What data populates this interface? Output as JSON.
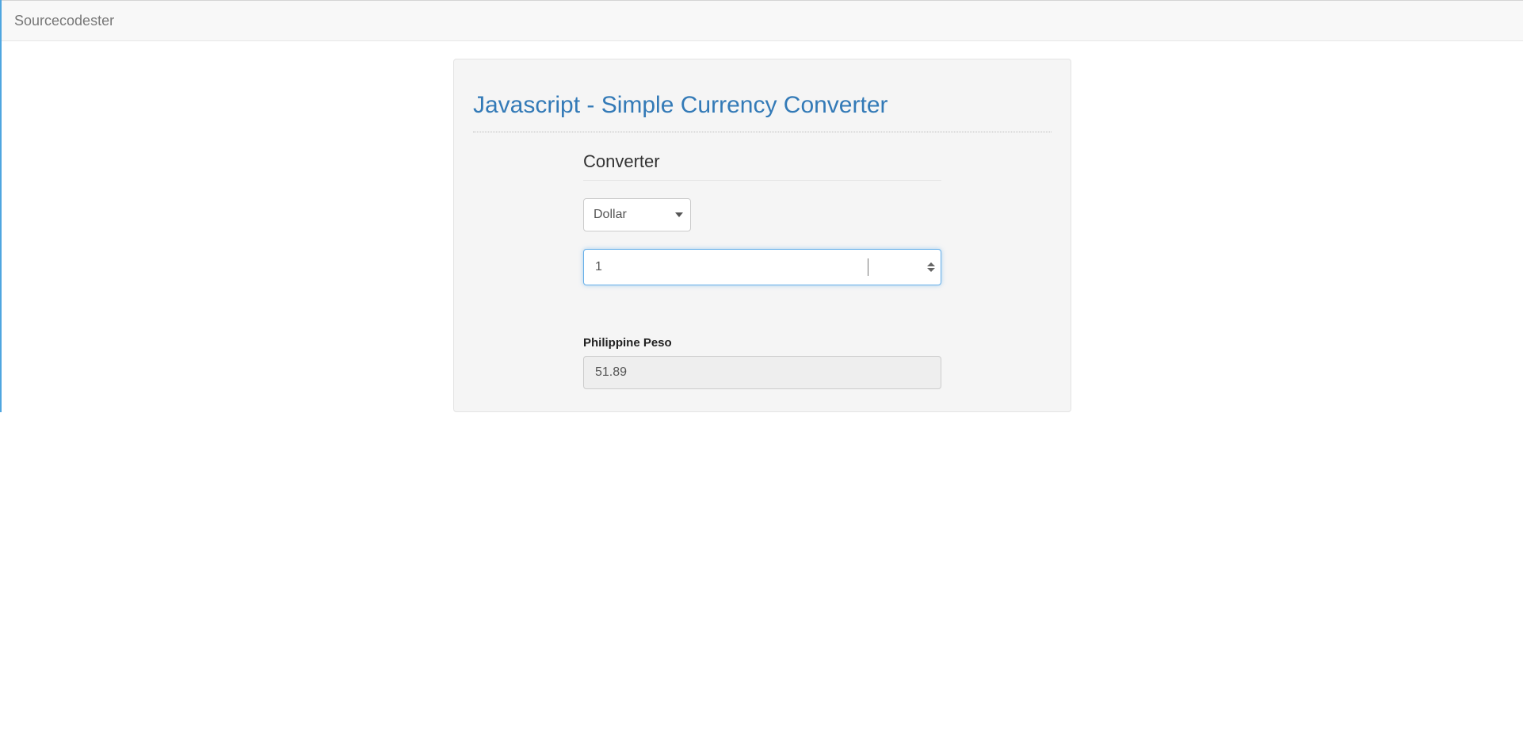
{
  "navbar": {
    "brand": "Sourcecodester"
  },
  "page": {
    "title": "Javascript - Simple Currency Converter"
  },
  "converter": {
    "heading": "Converter",
    "currency_selected": "Dollar",
    "amount_value": "1",
    "output_label": "Philippine Peso",
    "output_value": "51.89"
  }
}
